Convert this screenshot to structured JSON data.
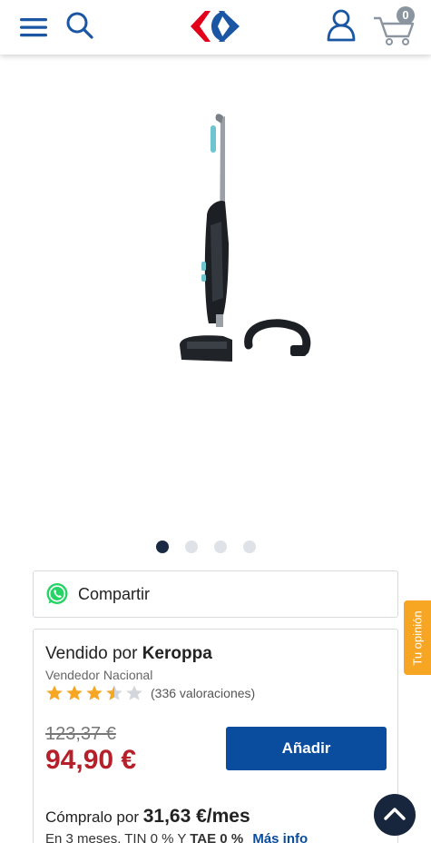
{
  "header": {
    "menu_icon": "hamburger-menu-icon",
    "search_icon": "search-icon",
    "logo": "carrefour-logo",
    "account_icon": "user-icon",
    "cart_icon": "cart-icon",
    "cart_count": "0"
  },
  "product": {
    "image": "stick-vacuum-cleaner-image",
    "carousel": {
      "count": 4,
      "active": 1
    }
  },
  "share": {
    "icon": "whatsapp-icon",
    "label": "Compartir"
  },
  "seller": {
    "sold_by_prefix": "Vendido por",
    "name": "Keroppa",
    "type": "Vendedor Nacional",
    "rating": 3.5,
    "rating_count": "(336 valoraciones)",
    "old_price": "123,37 €",
    "price": "94,90 €",
    "add_label": "Añadir",
    "installment_prefix": "Cómpralo por",
    "installment_amount": "31,63 €/mes",
    "installment_note_1": "En 3 meses. TIN 0 % Y",
    "installment_note_bold": "TAE 0 %",
    "more_info": "Más info"
  },
  "feedback_tab": "Tu opinión",
  "colors": {
    "brand_blue": "#0a4d9e",
    "price_red": "#b6202b",
    "star": "#f6a623",
    "feedback": "#f6a623"
  }
}
